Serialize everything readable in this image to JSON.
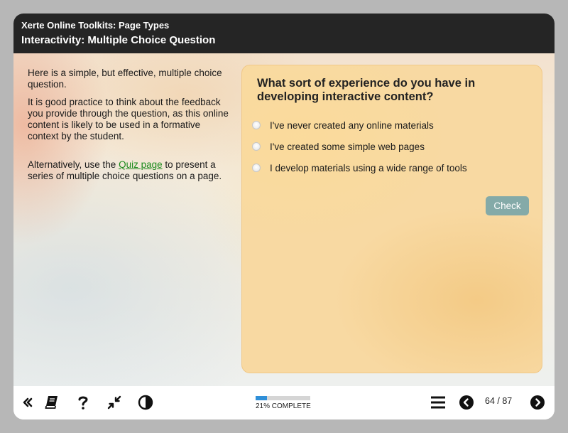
{
  "header": {
    "toolkit_title": "Xerte Online Toolkits: Page Types",
    "page_title": "Interactivity: Multiple Choice Question"
  },
  "left_text": {
    "p1": "Here is a simple, but effective, multiple choice question.",
    "p2": "It is good practice to think about the feedback you provide through the question, as this online content is likely to be used in a formative context by the student.",
    "p3_before": "Alternatively, use the ",
    "p3_link": "Quiz page",
    "p3_after": " to present a series of multiple choice questions on a page."
  },
  "question": {
    "text": "What sort of experience do you have in developing interactive content?",
    "options": [
      {
        "label": "I've never created any online materials",
        "selected": false
      },
      {
        "label": "I've created some simple web pages",
        "selected": false
      },
      {
        "label": "I develop materials using a wide range of tools",
        "selected": false
      }
    ],
    "check_label": "Check"
  },
  "footer": {
    "progress_value": 0.21,
    "progress_text": "21% COMPLETE",
    "page_indicator": "64 / 87",
    "icons": [
      "double-chevron-left-icon",
      "glossary-book-icon",
      "help-icon",
      "collapse-arrows-icon",
      "contrast-icon",
      "menu-icon",
      "previous-page-icon",
      "next-page-icon"
    ]
  },
  "colors": {
    "header_bg": "#252525",
    "panel_bg": "#f8d9a2",
    "check_button": "#84aaa8",
    "link": "#1c8a1c",
    "progress_fill": "#2f8fd8"
  }
}
